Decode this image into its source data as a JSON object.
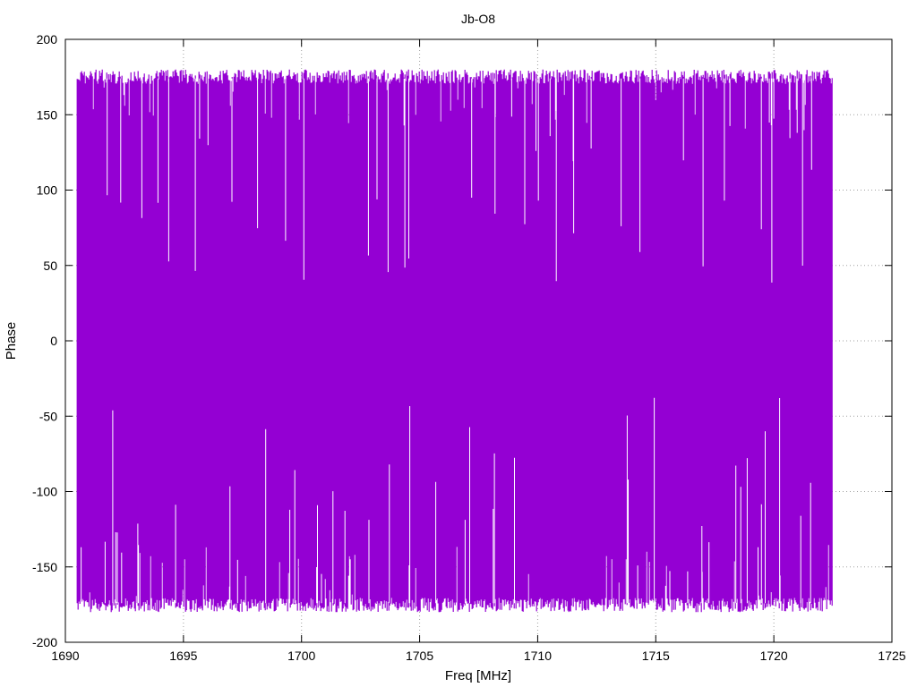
{
  "chart_data": {
    "type": "line",
    "title": "Jb-O8",
    "xlabel": "Freq [MHz]",
    "ylabel": "Phase",
    "xlim": [
      1690,
      1725
    ],
    "ylim": [
      -200,
      200
    ],
    "xticks": [
      1690,
      1695,
      1700,
      1705,
      1710,
      1715,
      1720,
      1725
    ],
    "yticks": [
      -200,
      -150,
      -100,
      -50,
      0,
      50,
      100,
      150,
      200
    ],
    "grid": true,
    "legend": "none",
    "series": [
      {
        "color": "#9400d3",
        "x_range": [
          1690.5,
          1722.5
        ],
        "value_range": [
          -180,
          180
        ],
        "description_values": "dense phase-wrapped trace spanning -180 to 180 degrees"
      }
    ]
  }
}
